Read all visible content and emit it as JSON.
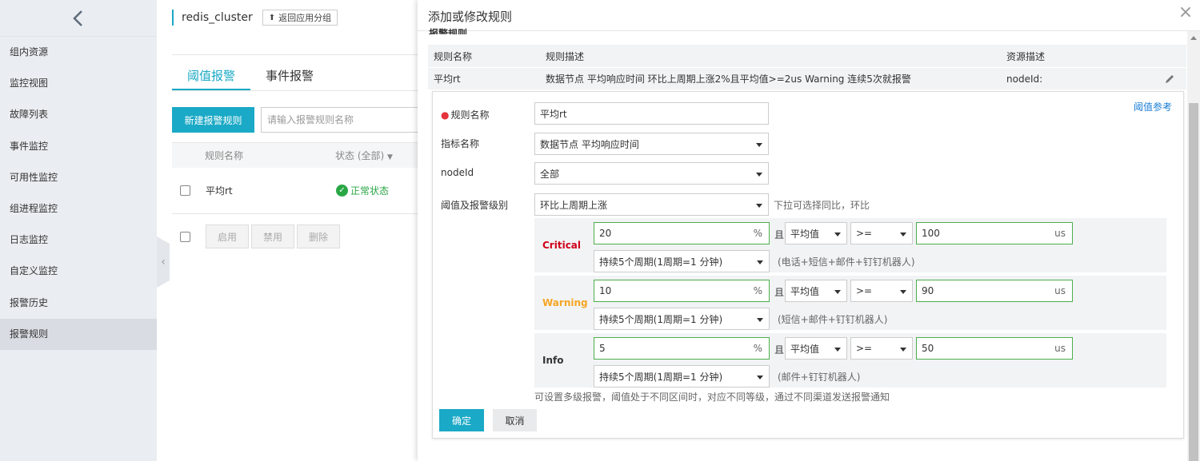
{
  "sidebar": {
    "items": [
      {
        "label": "组内资源"
      },
      {
        "label": "监控视图"
      },
      {
        "label": "故障列表"
      },
      {
        "label": "事件监控"
      },
      {
        "label": "可用性监控"
      },
      {
        "label": "组进程监控"
      },
      {
        "label": "日志监控"
      },
      {
        "label": "自定义监控"
      },
      {
        "label": "报警历史"
      },
      {
        "label": "报警规则"
      }
    ]
  },
  "app": {
    "title": "redis_cluster",
    "back_group_label": "返回应用分组"
  },
  "tabs": [
    {
      "label": "阈值报警"
    },
    {
      "label": "事件报警"
    }
  ],
  "list": {
    "new_rule_label": "新建报警规则",
    "search_placeholder": "请输入报警规则名称",
    "col_name": "规则名称",
    "col_status": "状态 (全部)",
    "rows": [
      {
        "name": "平均rt",
        "status": "正常状态"
      }
    ],
    "btn_enable": "启用",
    "btn_disable": "禁用",
    "btn_delete": "删除"
  },
  "modal": {
    "title": "添加或修改规则",
    "section_title": "报警规则",
    "table": {
      "headers": [
        "规则名称",
        "规则描述",
        "资源描述"
      ],
      "rows": [
        {
          "name": "平均rt",
          "desc": "数据节点 平均响应时间 环比上周期上涨2%且平均值>=2us Warning 连续5次就报警",
          "resource": "nodeId:"
        }
      ]
    },
    "form": {
      "threshold_ref": "阈值参考",
      "rule_name_label": "规则名称",
      "rule_name_value": "平均rt",
      "metric_label": "指标名称",
      "metric_value": "数据节点 平均响应时间",
      "nodeid_label": "nodeId",
      "nodeid_value": "全部",
      "threshold_label": "阈值及报警级别",
      "compare_value": "环比上周期上涨",
      "compare_hint": "下拉可选择同比，环比",
      "and_label": "且",
      "levels": [
        {
          "name": "Critical",
          "color": "#d0021b",
          "percent": "20",
          "percent_unit": "%",
          "agg": "平均值",
          "op": ">=",
          "value": "100",
          "unit": "us",
          "duration": "持续5个周期(1周期=1 分钟)",
          "channels": "(电话+短信+邮件+钉钉机器人)"
        },
        {
          "name": "Warning",
          "color": "#f5a623",
          "percent": "10",
          "percent_unit": "%",
          "agg": "平均值",
          "op": ">=",
          "value": "90",
          "unit": "us",
          "duration": "持续5个周期(1周期=1 分钟)",
          "channels": "(短信+邮件+钉钉机器人)"
        },
        {
          "name": "Info",
          "color": "#333333",
          "percent": "5",
          "percent_unit": "%",
          "agg": "平均值",
          "op": ">=",
          "value": "50",
          "unit": "us",
          "duration": "持续5个周期(1周期=1 分钟)",
          "channels": "(邮件+钉钉机器人)"
        }
      ],
      "multi_level_hint": "可设置多级报警，阈值处于不同区间时，对应不同等级，通过不同渠道发送报警通知",
      "ok_label": "确定",
      "cancel_label": "取消"
    }
  },
  "colors": {
    "accent": "#1aa9c6",
    "success": "#29a745",
    "required": "#e5343c",
    "link": "#1a7ed6"
  }
}
